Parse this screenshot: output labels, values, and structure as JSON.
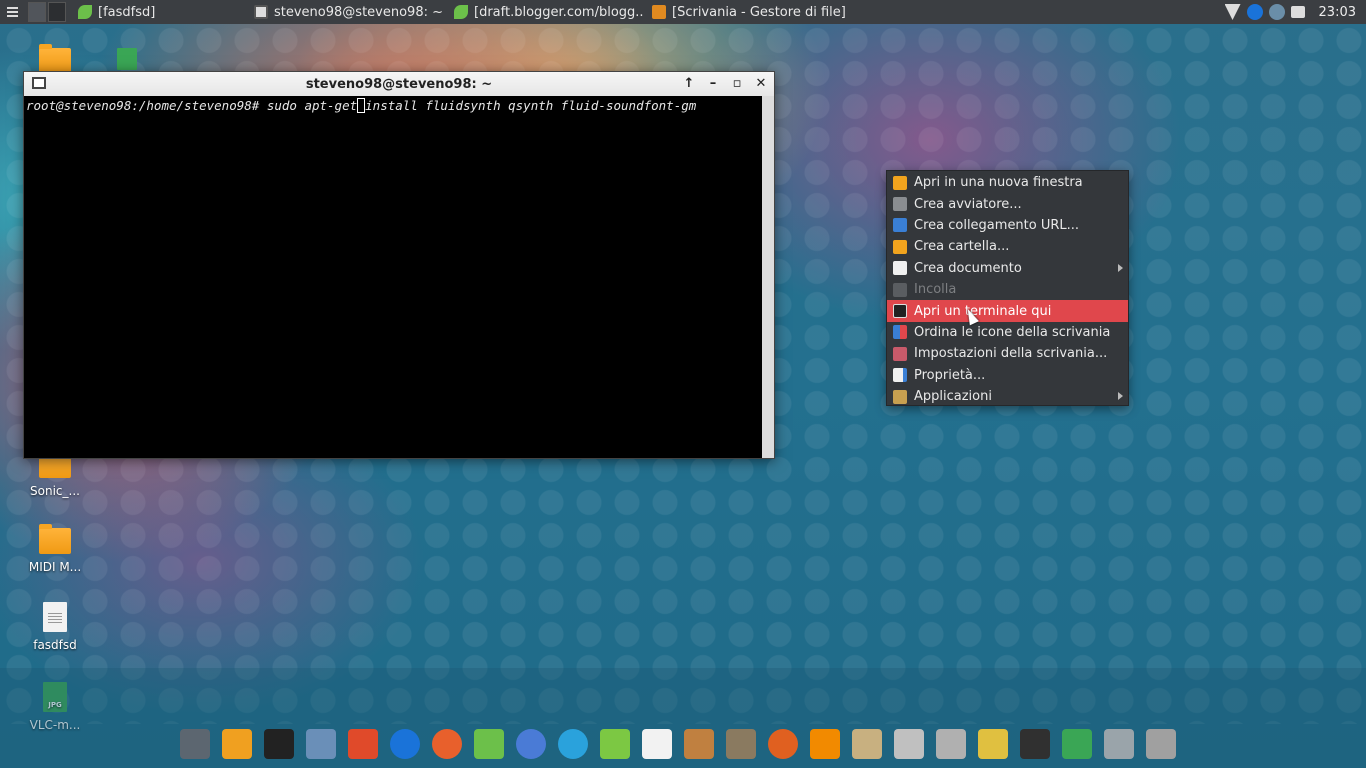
{
  "top_panel": {
    "tasks": [
      {
        "label": "[fasdfsd]",
        "icon": "leaf-icon"
      },
      {
        "label": "steveno98@steveno98: ~",
        "icon": "terminal-icon"
      },
      {
        "label": "[draft.blogger.com/blogg...",
        "icon": "leaf-icon"
      },
      {
        "label": "[Scrivania - Gestore di file]",
        "icon": "desktop-icon"
      }
    ],
    "clock": "23:03"
  },
  "desktop_icons": [
    {
      "label": "Sonic_...",
      "kind": "folder"
    },
    {
      "label": "MIDI M...",
      "kind": "folder"
    },
    {
      "label": "fasdfsd",
      "kind": "document"
    },
    {
      "label": "VLC-m...",
      "kind": "jpg",
      "badge": "JPG"
    }
  ],
  "terminal": {
    "title": "steveno98@steveno98: ~",
    "prompt": "root@steveno98:/home/steveno98# sudo apt-get",
    "command_rest": "install fluidsynth qsynth fluid-soundfont-gm"
  },
  "context_menu": {
    "items": [
      {
        "label": "Apri in una nuova finestra",
        "icon": "folder-open-icon",
        "state": "normal",
        "submenu": false
      },
      {
        "label": "Crea avviatore...",
        "icon": "launcher-icon",
        "state": "normal",
        "submenu": false
      },
      {
        "label": "Crea collegamento URL...",
        "icon": "link-icon",
        "state": "normal",
        "submenu": false
      },
      {
        "label": "Crea cartella...",
        "icon": "new-folder-icon",
        "state": "normal",
        "submenu": false
      },
      {
        "label": "Crea documento",
        "icon": "new-document-icon",
        "state": "normal",
        "submenu": true
      },
      {
        "label": "Incolla",
        "icon": "paste-icon",
        "state": "disabled",
        "submenu": false
      },
      {
        "label": "Apri un terminale qui",
        "icon": "terminal-icon",
        "state": "active",
        "submenu": false
      },
      {
        "label": "Ordina le icone della scrivania",
        "icon": "sort-icon",
        "state": "normal",
        "submenu": false
      },
      {
        "label": "Impostazioni della scrivania...",
        "icon": "settings-icon",
        "state": "normal",
        "submenu": false
      },
      {
        "label": "Proprietà...",
        "icon": "properties-icon",
        "state": "normal",
        "submenu": false
      },
      {
        "label": "Applicazioni",
        "icon": "applications-icon",
        "state": "normal",
        "submenu": true
      }
    ]
  },
  "dock": {
    "apps": [
      {
        "name": "monitor-icon",
        "color": "#5c6670"
      },
      {
        "name": "file-manager-icon",
        "color": "#f0a020"
      },
      {
        "name": "xterm-icon",
        "color": "#222222"
      },
      {
        "name": "virtualbox-icon",
        "color": "#6a8fb8"
      },
      {
        "name": "windows-icon",
        "color": "#e04a2a"
      },
      {
        "name": "teamviewer-icon",
        "color": "#1a73d9"
      },
      {
        "name": "firefox-icon",
        "color": "#e8602c"
      },
      {
        "name": "leaf-browser-icon",
        "color": "#6cc04a"
      },
      {
        "name": "chromium-icon",
        "color": "#4a7bd6"
      },
      {
        "name": "telegram-icon",
        "color": "#2aa2dc"
      },
      {
        "name": "feather-editor-icon",
        "color": "#7cc843"
      },
      {
        "name": "blank-document-icon",
        "color": "#f2f2f2"
      },
      {
        "name": "brush-icon",
        "color": "#c08040"
      },
      {
        "name": "gimp-icon",
        "color": "#8a7a60"
      },
      {
        "name": "drop-icon",
        "color": "#e06020"
      },
      {
        "name": "vlc-icon",
        "color": "#f28a00"
      },
      {
        "name": "disk-usage-icon",
        "color": "#c8b080"
      },
      {
        "name": "package-icon",
        "color": "#c0c0c0"
      },
      {
        "name": "screenshot-icon",
        "color": "#b0b0b0"
      },
      {
        "name": "cleaner-icon",
        "color": "#e0c040"
      },
      {
        "name": "system-monitor-icon",
        "color": "#303030"
      },
      {
        "name": "download-icon",
        "color": "#3aa655"
      },
      {
        "name": "trash-icon",
        "color": "#9aa4aa"
      },
      {
        "name": "network-icon",
        "color": "#a0a0a0"
      }
    ]
  }
}
